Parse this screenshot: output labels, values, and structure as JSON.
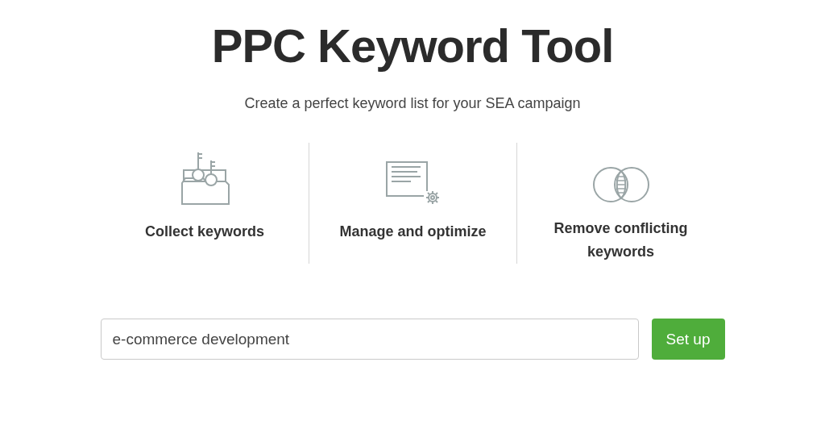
{
  "title": "PPC Keyword Tool",
  "subtitle": "Create a perfect keyword list for your SEA campaign",
  "features": [
    {
      "kind": "folder",
      "label": "Collect keywords"
    },
    {
      "kind": "document",
      "label": "Manage and optimize"
    },
    {
      "kind": "overlap",
      "label": "Remove conflicting keywords"
    }
  ],
  "search": {
    "value": "e-commerce development"
  },
  "button": "Set up"
}
